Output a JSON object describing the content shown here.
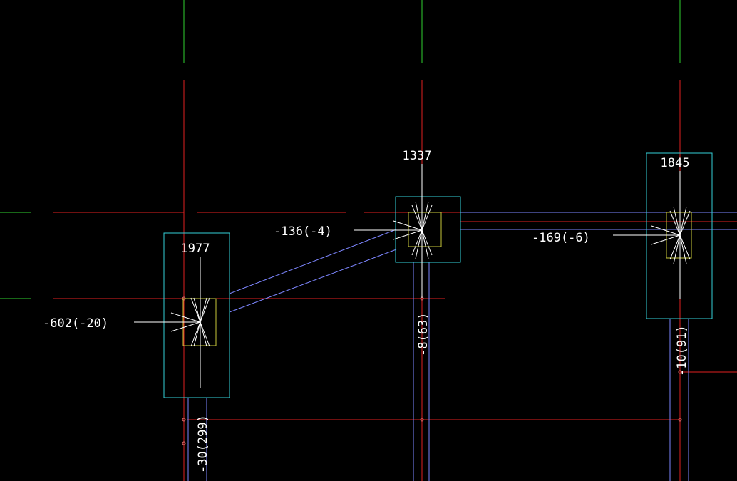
{
  "drawing": {
    "colors": {
      "background": "#000000",
      "axis_green": "#2fd02f",
      "axis_red": "#e02020",
      "beam_blue": "#7d86ff",
      "column_cyan": "#33d0d8",
      "section_yellow": "#c8c83a",
      "load_white": "#ffffff"
    },
    "columns": [
      {
        "id": "col-left",
        "axial_force": "1977",
        "moment_label": "-602(-20)",
        "vertical_label": "-30(299)"
      },
      {
        "id": "col-mid",
        "axial_force": "1337",
        "moment_label": "-136(-4)",
        "vertical_label": "-8(63)"
      },
      {
        "id": "col-right",
        "axial_force": "1845",
        "moment_label": "-169(-6)",
        "vertical_label": "-10(91)"
      }
    ]
  }
}
